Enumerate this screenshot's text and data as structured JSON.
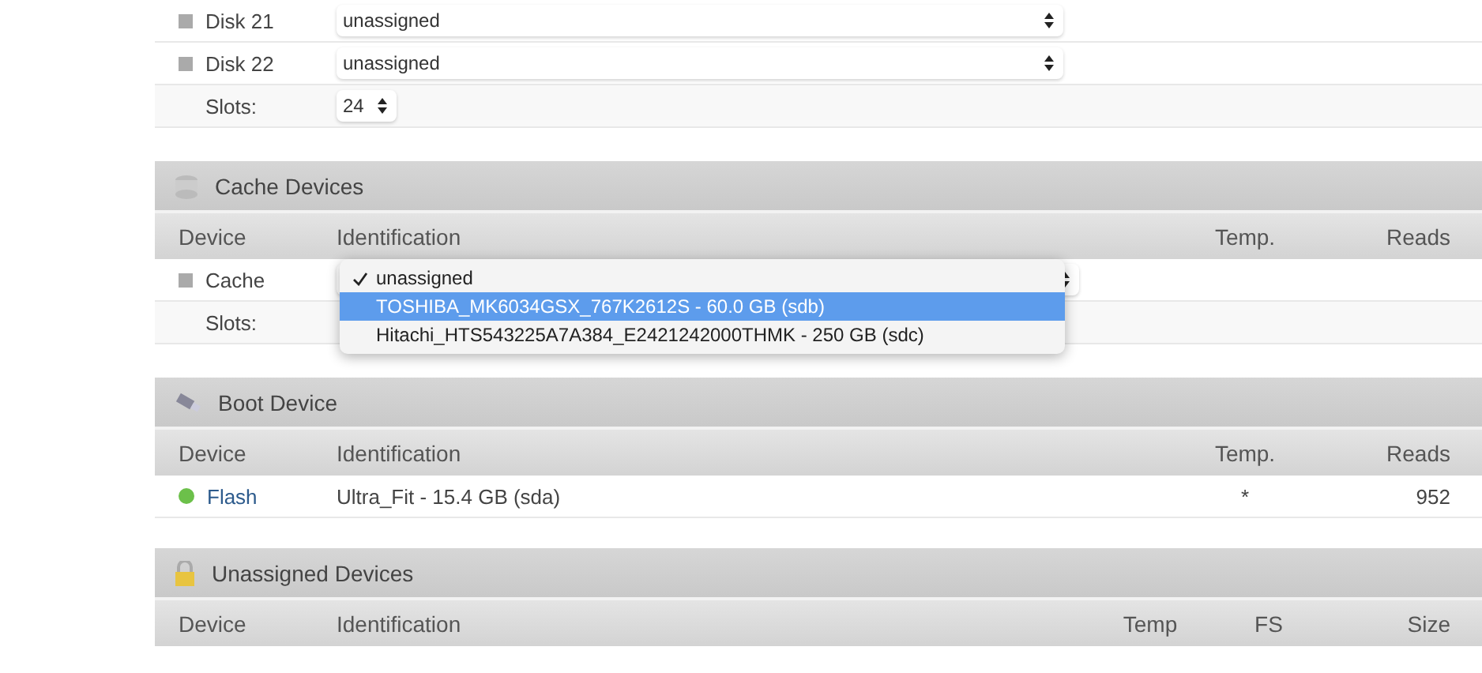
{
  "array_rows": [
    {
      "kind": "device",
      "name": "Disk 21",
      "value": "unassigned"
    },
    {
      "kind": "device",
      "name": "Disk 22",
      "value": "unassigned"
    },
    {
      "kind": "slots",
      "name": "Slots:",
      "value": "24"
    }
  ],
  "sections": [
    {
      "kind": "cache",
      "title": "Cache Devices",
      "columns": [
        "Device",
        "Identification",
        "Temp.",
        "Reads"
      ],
      "rows": [
        {
          "kind": "device",
          "cells": [
            "Cache"
          ],
          "open": true,
          "options": [
            {
              "label": "unassigned",
              "checked": true,
              "highlighted": false
            },
            {
              "label": "TOSHIBA_MK6034GSX_767K2612S - 60.0 GB (sdb)",
              "checked": false,
              "highlighted": true
            },
            {
              "label": "Hitachi_HTS543225A7A384_E2421242000THMK - 250 GB (sdc)",
              "checked": false,
              "highlighted": false
            }
          ]
        },
        {
          "kind": "slots",
          "cells": [
            "Slots:"
          ]
        }
      ]
    },
    {
      "kind": "boot",
      "title": "Boot Device",
      "columns": [
        "Device",
        "Identification",
        "Temp.",
        "Reads"
      ],
      "rows": [
        {
          "kind": "status",
          "color": "#6cc04a",
          "cells": [
            "Flash",
            "Ultra_Fit - 15.4 GB (sda)",
            "*",
            "952"
          ]
        }
      ]
    },
    {
      "kind": "unassigned",
      "title": "Unassigned Devices",
      "columns": [
        "Device",
        "Identification",
        "Temp",
        "FS",
        "Size"
      ]
    }
  ]
}
